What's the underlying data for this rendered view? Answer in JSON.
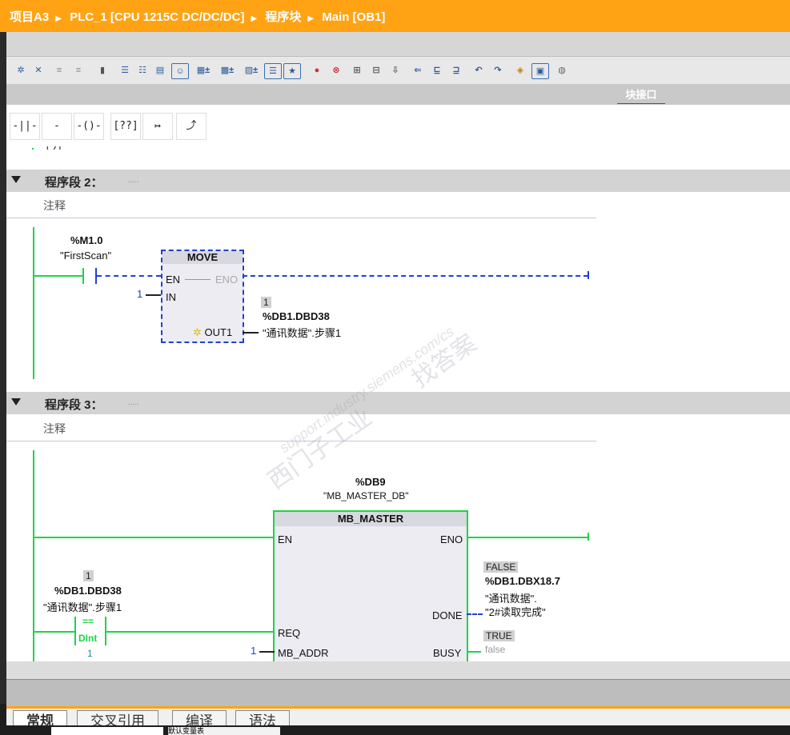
{
  "titlebar": {
    "crumbs": [
      "项目A3",
      "PLC_1 [CPU 1215C DC/DC/DC]",
      "程序块",
      "Main [OB1]"
    ],
    "separator": "▶"
  },
  "toolbar": {
    "icons": [
      "insert-network-icon",
      "delete-network-icon",
      "insert-row-icon",
      "add-row-icon",
      "branch-icon",
      "list-icon",
      "list-alt-icon",
      "block-icon",
      "comment-icon",
      "absolute-operand-icon",
      "symbolic-operand-icon",
      "symbol-info-icon",
      "outline-icon",
      "favorites-icon",
      "breakpoint-icon",
      "clear-breakpoint-icon",
      "set-icon",
      "reset-icon",
      "step-icon",
      "go-to-icon",
      "jump-icon",
      "jump-back-icon",
      "call-icon",
      "return-icon",
      "monitor-icon",
      "monitor-toggle-icon",
      "database-icon"
    ]
  },
  "block_interface_label": "块接口",
  "ladder_elements": [
    "-||-",
    "-|/|-",
    "-()-",
    "[??]",
    "↦",
    "⤴"
  ],
  "network2": {
    "title": "程序段 2：",
    "dots": ".....",
    "comment": "注释",
    "contact": {
      "address": "%M1.0",
      "symbol": "\"FirstScan\""
    },
    "box": {
      "name": "MOVE",
      "en": "EN",
      "eno": "ENO",
      "in": "IN",
      "out": "OUT1",
      "in_value": "1"
    },
    "output": {
      "value": "1",
      "address": "%DB1.DBD38",
      "symbol": "\"通讯数据\".步骤1"
    }
  },
  "network3": {
    "title": "程序段 3：",
    "dots": ".....",
    "comment": "注释",
    "instance": {
      "address": "%DB9",
      "symbol": "\"MB_MASTER_DB\""
    },
    "box": {
      "name": "MB_MASTER",
      "en": "EN",
      "eno": "ENO",
      "req": "REQ",
      "mb_addr": "MB_ADDR",
      "done": "DONE",
      "busy": "BUSY",
      "mb_addr_value": "1"
    },
    "compare": {
      "value": "1",
      "address": "%DB1.DBD38",
      "symbol": "\"通讯数据\".步骤1",
      "op": "==",
      "type": "DInt",
      "value2": "1"
    },
    "done_out": {
      "value": "FALSE",
      "address": "%DB1.DBX18.7",
      "symbol_line1": "\"通讯数据\".",
      "symbol_line2": "\"2#读取完成\""
    },
    "busy_out": {
      "value": "TRUE",
      "text": "false"
    }
  },
  "watermark": {
    "line1": "西门子工业",
    "line2": "找答案",
    "line3": "support.industry.siemens.com/cs"
  },
  "tabs": [
    "常规",
    "交叉引用",
    "编译",
    "语法"
  ],
  "bottom": {
    "item": "默认变量表"
  }
}
